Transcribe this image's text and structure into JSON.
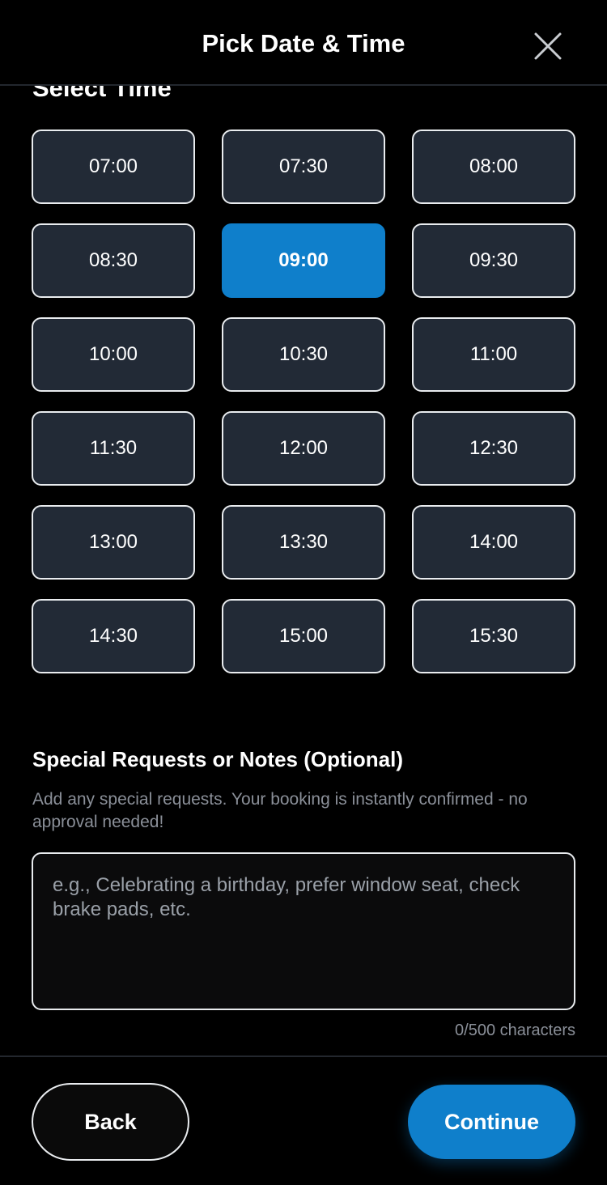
{
  "header": {
    "title": "Pick Date & Time",
    "close_icon": "close-icon"
  },
  "time_section": {
    "title": "Select Time",
    "selected": "09:00",
    "slots": [
      "07:00",
      "07:30",
      "08:00",
      "08:30",
      "09:00",
      "09:30",
      "10:00",
      "10:30",
      "11:00",
      "11:30",
      "12:00",
      "12:30",
      "13:00",
      "13:30",
      "14:00",
      "14:30",
      "15:00",
      "15:30"
    ]
  },
  "notes": {
    "title": "Special Requests or Notes (Optional)",
    "help": "Add any special requests. Your booking is instantly confirmed - no approval needed!",
    "placeholder": "e.g., Celebrating a birthday, prefer window seat, check brake pads, etc.",
    "value": "",
    "char_count": "0/500 characters"
  },
  "footer": {
    "back_label": "Back",
    "continue_label": "Continue"
  },
  "colors": {
    "accent": "#0f7fcb",
    "slot_background": "#222a36",
    "background": "#000000"
  }
}
